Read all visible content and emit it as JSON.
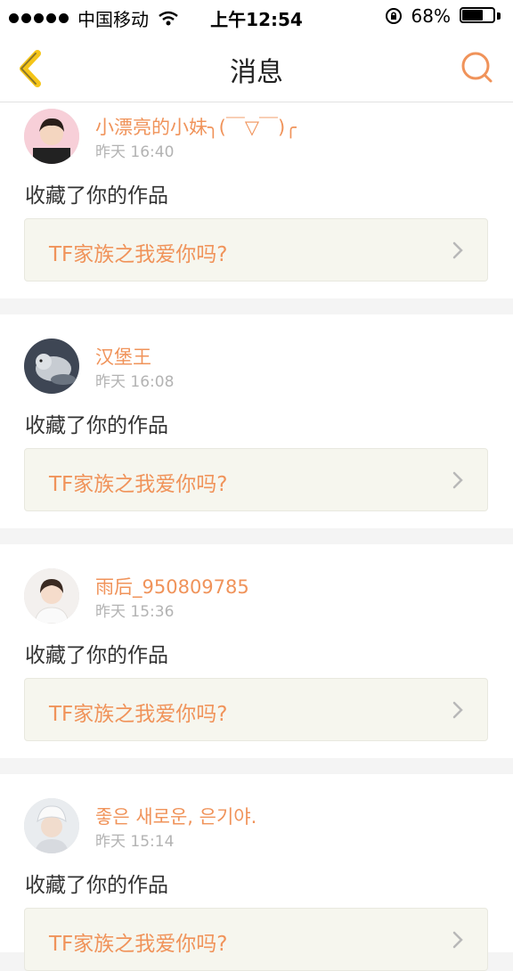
{
  "status_bar": {
    "carrier": "中国移动",
    "time": "上午12:54",
    "battery_percent": "68%",
    "battery_level": 0.68
  },
  "nav": {
    "title": "消息",
    "back_icon": "chevron-left-icon",
    "search_icon": "search-icon"
  },
  "colors": {
    "accent": "#f0935a",
    "back_icon": "#f5c518"
  },
  "messages": [
    {
      "username": "小漂亮的小妹╮(￣▽￣)╭",
      "time": "昨天 16:40",
      "action": "收藏了你的作品",
      "work_title": "TF家族之我爱你吗?"
    },
    {
      "username": "汉堡王",
      "time": "昨天 16:08",
      "action": "收藏了你的作品",
      "work_title": "TF家族之我爱你吗?"
    },
    {
      "username": "雨后_950809785",
      "time": "昨天 15:36",
      "action": "收藏了你的作品",
      "work_title": "TF家族之我爱你吗?"
    },
    {
      "username": "좋은 새로운, 은기야.",
      "time": "昨天 15:14",
      "action": "收藏了你的作品",
      "work_title": "TF家族之我爱你吗?"
    }
  ]
}
